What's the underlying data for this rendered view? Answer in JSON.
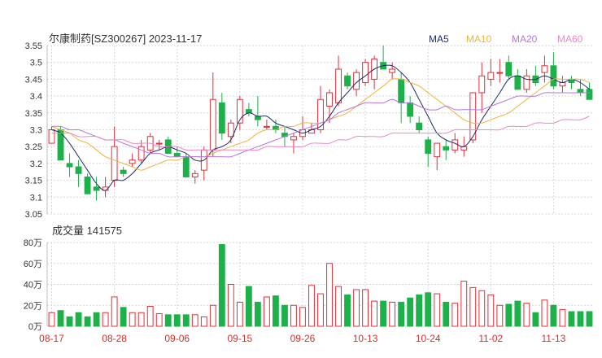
{
  "header": {
    "title": "尔康制药[SZ300267] 2023-11-17",
    "legend": [
      {
        "label": "MA5",
        "color": "#1f2a6b"
      },
      {
        "label": "MA10",
        "color": "#f0b43c"
      },
      {
        "label": "MA20",
        "color": "#b277e0"
      },
      {
        "label": "MA60",
        "color": "#ee86c8"
      }
    ]
  },
  "volume_header": {
    "label": "成交量 141575"
  },
  "colors": {
    "up": "#e0303a",
    "down": "#1db149",
    "grid": "#d6d6d6",
    "date_text": "#d2302c"
  },
  "chart_data": [
    {
      "type": "candlestick",
      "title": "尔康制药[SZ300267] 2023-11-17",
      "ylim": [
        3.05,
        3.55
      ],
      "yticks": [
        "3.55",
        "3.5",
        "3.45",
        "3.4",
        "3.35",
        "3.3",
        "3.25",
        "3.2",
        "3.15",
        "3.1",
        "3.05"
      ],
      "x": [
        "08-17",
        "08-18",
        "08-21",
        "08-22",
        "08-23",
        "08-24",
        "08-25",
        "08-28",
        "08-29",
        "08-30",
        "08-31",
        "09-01",
        "09-04",
        "09-05",
        "09-06",
        "09-07",
        "09-08",
        "09-11",
        "09-12",
        "09-13",
        "09-14",
        "09-15",
        "09-18",
        "09-19",
        "09-20",
        "09-21",
        "09-22",
        "09-25",
        "09-26",
        "09-27",
        "09-28",
        "10-09",
        "10-10",
        "10-11",
        "10-12",
        "10-13",
        "10-16",
        "10-17",
        "10-18",
        "10-19",
        "10-20",
        "10-23",
        "10-24",
        "10-25",
        "10-26",
        "10-27",
        "10-30",
        "10-31",
        "11-01",
        "11-02",
        "11-03",
        "11-06",
        "11-07",
        "11-08",
        "11-09",
        "11-10",
        "11-13",
        "11-14",
        "11-15",
        "11-16",
        "11-17"
      ],
      "xticks": [
        "08-17",
        "08-28",
        "09-06",
        "09-15",
        "09-26",
        "10-13",
        "10-24",
        "11-02",
        "11-13"
      ],
      "ohlc": [
        [
          3.26,
          3.31,
          3.26,
          3.3
        ],
        [
          3.3,
          3.31,
          3.21,
          3.21
        ],
        [
          3.2,
          3.23,
          3.16,
          3.19
        ],
        [
          3.19,
          3.21,
          3.13,
          3.17
        ],
        [
          3.16,
          3.17,
          3.11,
          3.11
        ],
        [
          3.13,
          3.16,
          3.09,
          3.12
        ],
        [
          3.12,
          3.16,
          3.1,
          3.13
        ],
        [
          3.15,
          3.31,
          3.13,
          3.25
        ],
        [
          3.18,
          3.19,
          3.16,
          3.17
        ],
        [
          3.2,
          3.23,
          3.19,
          3.21
        ],
        [
          3.21,
          3.27,
          3.2,
          3.25
        ],
        [
          3.24,
          3.29,
          3.23,
          3.28
        ],
        [
          3.26,
          3.27,
          3.24,
          3.26
        ],
        [
          3.27,
          3.28,
          3.25,
          3.23
        ],
        [
          3.23,
          3.25,
          3.22,
          3.22
        ],
        [
          3.22,
          3.23,
          3.16,
          3.16
        ],
        [
          3.16,
          3.18,
          3.14,
          3.17
        ],
        [
          3.18,
          3.25,
          3.15,
          3.24
        ],
        [
          3.24,
          3.47,
          3.22,
          3.39
        ],
        [
          3.38,
          3.41,
          3.27,
          3.29
        ],
        [
          3.28,
          3.33,
          3.26,
          3.32
        ],
        [
          3.32,
          3.4,
          3.3,
          3.39
        ],
        [
          3.36,
          3.38,
          3.34,
          3.35
        ],
        [
          3.34,
          3.4,
          3.31,
          3.33
        ],
        [
          3.31,
          3.33,
          3.3,
          3.31
        ],
        [
          3.31,
          3.33,
          3.29,
          3.3
        ],
        [
          3.29,
          3.31,
          3.25,
          3.28
        ],
        [
          3.27,
          3.29,
          3.23,
          3.28
        ],
        [
          3.28,
          3.34,
          3.27,
          3.3
        ],
        [
          3.29,
          3.32,
          3.29,
          3.3
        ],
        [
          3.3,
          3.43,
          3.29,
          3.39
        ],
        [
          3.37,
          3.42,
          3.32,
          3.41
        ],
        [
          3.38,
          3.52,
          3.37,
          3.48
        ],
        [
          3.46,
          3.47,
          3.42,
          3.43
        ],
        [
          3.42,
          3.48,
          3.4,
          3.47
        ],
        [
          3.44,
          3.51,
          3.43,
          3.5
        ],
        [
          3.45,
          3.52,
          3.42,
          3.51
        ],
        [
          3.5,
          3.55,
          3.48,
          3.48
        ],
        [
          3.47,
          3.5,
          3.45,
          3.48
        ],
        [
          3.45,
          3.47,
          3.32,
          3.38
        ],
        [
          3.38,
          3.4,
          3.32,
          3.34
        ],
        [
          3.32,
          3.34,
          3.29,
          3.3
        ],
        [
          3.27,
          3.28,
          3.19,
          3.23
        ],
        [
          3.22,
          3.25,
          3.18,
          3.26
        ],
        [
          3.25,
          3.27,
          3.21,
          3.24
        ],
        [
          3.24,
          3.29,
          3.23,
          3.27
        ],
        [
          3.24,
          3.28,
          3.22,
          3.25
        ],
        [
          3.27,
          3.41,
          3.26,
          3.41
        ],
        [
          3.41,
          3.5,
          3.35,
          3.46
        ],
        [
          3.45,
          3.51,
          3.43,
          3.47
        ],
        [
          3.47,
          3.51,
          3.44,
          3.47
        ],
        [
          3.5,
          3.52,
          3.45,
          3.46
        ],
        [
          3.46,
          3.48,
          3.42,
          3.42
        ],
        [
          3.42,
          3.48,
          3.41,
          3.46
        ],
        [
          3.46,
          3.49,
          3.43,
          3.44
        ],
        [
          3.47,
          3.52,
          3.44,
          3.49
        ],
        [
          3.49,
          3.53,
          3.42,
          3.43
        ],
        [
          3.43,
          3.46,
          3.41,
          3.44
        ],
        [
          3.45,
          3.46,
          3.42,
          3.44
        ],
        [
          3.42,
          3.45,
          3.4,
          3.41
        ],
        [
          3.42,
          3.44,
          3.4,
          3.39
        ]
      ],
      "series": [
        {
          "name": "MA5",
          "values": [
            3.3,
            3.29,
            3.26,
            3.22,
            3.18,
            3.14,
            3.12,
            3.15,
            3.15,
            3.17,
            3.2,
            3.23,
            3.24,
            3.25,
            3.24,
            3.23,
            3.21,
            3.21,
            3.24,
            3.25,
            3.27,
            3.33,
            3.35,
            3.34,
            3.34,
            3.32,
            3.31,
            3.3,
            3.29,
            3.3,
            3.31,
            3.34,
            3.38,
            3.41,
            3.44,
            3.46,
            3.48,
            3.49,
            3.49,
            3.47,
            3.44,
            3.39,
            3.34,
            3.29,
            3.27,
            3.26,
            3.25,
            3.28,
            3.33,
            3.37,
            3.41,
            3.45,
            3.46,
            3.45,
            3.45,
            3.46,
            3.45,
            3.44,
            3.45,
            3.44,
            3.42
          ]
        },
        {
          "name": "MA10",
          "values": [
            3.31,
            3.3,
            3.29,
            3.27,
            3.26,
            3.24,
            3.22,
            3.21,
            3.2,
            3.19,
            3.18,
            3.19,
            3.2,
            3.21,
            3.21,
            3.22,
            3.22,
            3.22,
            3.23,
            3.24,
            3.25,
            3.26,
            3.27,
            3.29,
            3.3,
            3.3,
            3.31,
            3.31,
            3.32,
            3.32,
            3.32,
            3.33,
            3.34,
            3.35,
            3.37,
            3.39,
            3.41,
            3.43,
            3.45,
            3.45,
            3.44,
            3.43,
            3.41,
            3.39,
            3.37,
            3.35,
            3.33,
            3.32,
            3.32,
            3.33,
            3.34,
            3.35,
            3.37,
            3.39,
            3.41,
            3.43,
            3.45,
            3.45,
            3.45,
            3.45,
            3.44
          ]
        },
        {
          "name": "MA20",
          "values": [
            3.31,
            3.31,
            3.3,
            3.3,
            3.29,
            3.28,
            3.27,
            3.27,
            3.26,
            3.25,
            3.24,
            3.23,
            3.23,
            3.22,
            3.22,
            3.22,
            3.22,
            3.22,
            3.22,
            3.22,
            3.22,
            3.23,
            3.24,
            3.25,
            3.26,
            3.27,
            3.28,
            3.29,
            3.3,
            3.31,
            3.32,
            3.33,
            3.35,
            3.36,
            3.37,
            3.38,
            3.38,
            3.38,
            3.39,
            3.38,
            3.38,
            3.37,
            3.36,
            3.36,
            3.37,
            3.36,
            3.36,
            3.36,
            3.36,
            3.37,
            3.38,
            3.39,
            3.4,
            3.4,
            3.4,
            3.41,
            3.41,
            3.41,
            3.41,
            3.41,
            3.41
          ]
        },
        {
          "name": "MA60",
          "values": [
            3.29,
            3.29,
            3.29,
            3.28,
            3.28,
            3.28,
            3.27,
            3.27,
            3.27,
            3.26,
            3.26,
            3.26,
            3.25,
            3.25,
            3.25,
            3.24,
            3.24,
            3.24,
            3.24,
            3.24,
            3.24,
            3.24,
            3.24,
            3.24,
            3.25,
            3.25,
            3.25,
            3.25,
            3.25,
            3.26,
            3.26,
            3.26,
            3.27,
            3.27,
            3.28,
            3.28,
            3.28,
            3.28,
            3.29,
            3.29,
            3.29,
            3.29,
            3.29,
            3.29,
            3.29,
            3.3,
            3.3,
            3.3,
            3.3,
            3.3,
            3.3,
            3.31,
            3.31,
            3.31,
            3.32,
            3.32,
            3.32,
            3.33,
            3.33,
            3.33,
            3.34
          ]
        }
      ]
    },
    {
      "type": "bar",
      "title": "成交量 141575",
      "ylim": [
        0,
        80
      ],
      "yticks": [
        "80万",
        "60万",
        "40万",
        "20万",
        "0万"
      ],
      "unit": "万",
      "values": [
        13,
        15,
        9,
        13,
        9,
        13,
        13,
        28,
        18,
        13,
        13,
        19,
        12,
        11,
        11,
        11,
        11,
        9,
        20,
        78,
        40,
        23,
        38,
        23,
        28,
        29,
        20,
        20,
        18,
        39,
        31,
        60,
        38,
        30,
        35,
        35,
        24,
        24,
        23,
        23,
        27,
        30,
        32,
        31,
        23,
        22,
        43,
        37,
        34,
        30,
        20,
        21,
        24,
        22,
        13,
        25,
        20,
        16,
        14,
        14,
        14
      ]
    }
  ]
}
